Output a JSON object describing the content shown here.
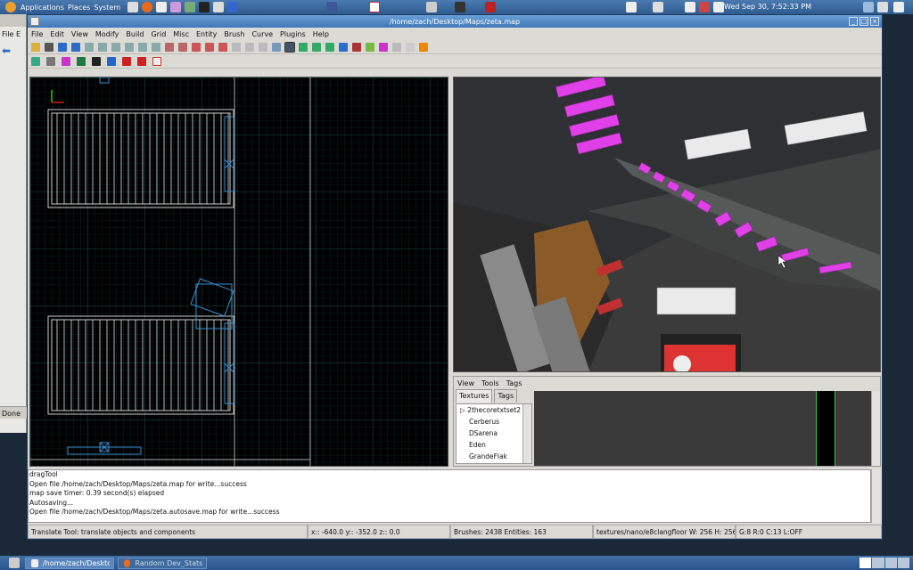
{
  "topbar": {
    "applications": "Applications",
    "places": "Places",
    "system": "System",
    "clock": "Wed Sep 30,  7:52:33 PM"
  },
  "bottombar": {
    "task1": "/home/zach/Deskto···",
    "task2": "Random Dev_Stats - ···"
  },
  "background_window": {
    "status": "Done",
    "menu_f": "File",
    "menu_e": "E"
  },
  "window": {
    "title": "/home/zach/Desktop/Maps/zeta.map"
  },
  "menu": [
    "File",
    "Edit",
    "View",
    "Modify",
    "Build",
    "Grid",
    "Misc",
    "Entity",
    "Brush",
    "Curve",
    "Plugins",
    "Help"
  ],
  "texture_panel": {
    "menus": [
      "View",
      "Tools",
      "Tags"
    ],
    "tabs": [
      "Textures",
      "Tags"
    ],
    "items": [
      "2thecoretxtset2",
      "Cerberus",
      "DSarena",
      "Eden",
      "GrandeFlak"
    ]
  },
  "console": {
    "lines": [
      "dragTool",
      "Open file /home/zach/Desktop/Maps/zeta.map for write...success",
      "map save timer:  0.39 second(s) elapsed",
      "Autosaving...",
      "Open file /home/zach/Desktop/Maps/zeta.autosave.map for write...success"
    ]
  },
  "status": {
    "tool": "Translate Tool: translate objects and components",
    "coords": "x:: -640.0  y:: -352.0  z::   0.0",
    "counts": "Brushes: 2438 Entities: 163",
    "texture": "textures/nano/e8clangfloor W: 256 H: 256",
    "grid": "G:8  R:0  C:13  L:OFF"
  },
  "colors": {
    "accent": "#3f78b9",
    "grid": "#1e4a48",
    "brush": "#e6e6e6",
    "selected": "#3a8ed0",
    "magenta": "#e040e8"
  }
}
